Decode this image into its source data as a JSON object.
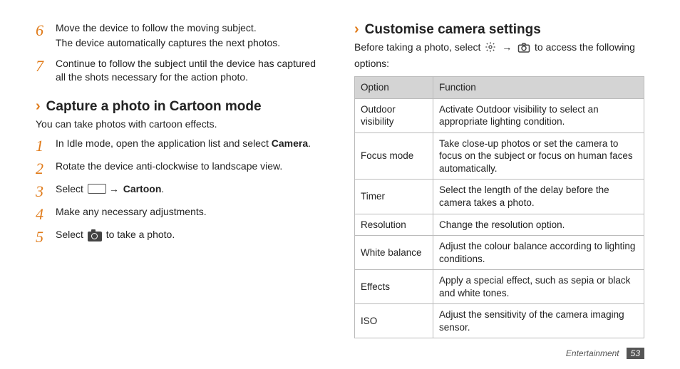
{
  "left": {
    "pre_steps": [
      {
        "num": "6",
        "lines": [
          "Move the device to follow the moving subject.",
          "The device automatically captures the next photos."
        ]
      },
      {
        "num": "7",
        "lines": [
          "Continue to follow the subject until the device has captured all the shots necessary for the action photo."
        ]
      }
    ],
    "heading": "Capture a photo in Cartoon mode",
    "intro": "You can take photos with cartoon effects.",
    "steps": {
      "s1": {
        "num": "1",
        "a": "In Idle mode, open the application list and select ",
        "b": "Camera",
        "c": "."
      },
      "s2": {
        "num": "2",
        "text": "Rotate the device anti-clockwise to landscape view."
      },
      "s3": {
        "num": "3",
        "a": "Select ",
        "arrow": "→",
        "b": "Cartoon",
        "c": "."
      },
      "s4": {
        "num": "4",
        "text": "Make any necessary adjustments."
      },
      "s5": {
        "num": "5",
        "a": "Select ",
        "b": " to take a photo."
      }
    }
  },
  "right": {
    "heading": "Customise camera settings",
    "intro_a": "Before taking a photo, select ",
    "intro_arrow": "→",
    "intro_b": " to access the following options:",
    "table": {
      "head": {
        "c1": "Option",
        "c2": "Function"
      },
      "rows": [
        {
          "opt": "Outdoor visibility",
          "fn": "Activate Outdoor visibility to select an appropriate lighting condition."
        },
        {
          "opt": "Focus mode",
          "fn": "Take close-up photos or set the camera to focus on the subject or focus on human faces automatically."
        },
        {
          "opt": "Timer",
          "fn": "Select the length of the delay before the camera takes a photo."
        },
        {
          "opt": "Resolution",
          "fn": "Change the resolution option."
        },
        {
          "opt": "White balance",
          "fn": "Adjust the colour balance according to lighting conditions."
        },
        {
          "opt": "Effects",
          "fn": "Apply a special effect, such as sepia or black and white tones."
        },
        {
          "opt": "ISO",
          "fn": "Adjust the sensitivity of the camera imaging sensor."
        }
      ]
    }
  },
  "footer": {
    "section": "Entertainment",
    "page": "53"
  }
}
